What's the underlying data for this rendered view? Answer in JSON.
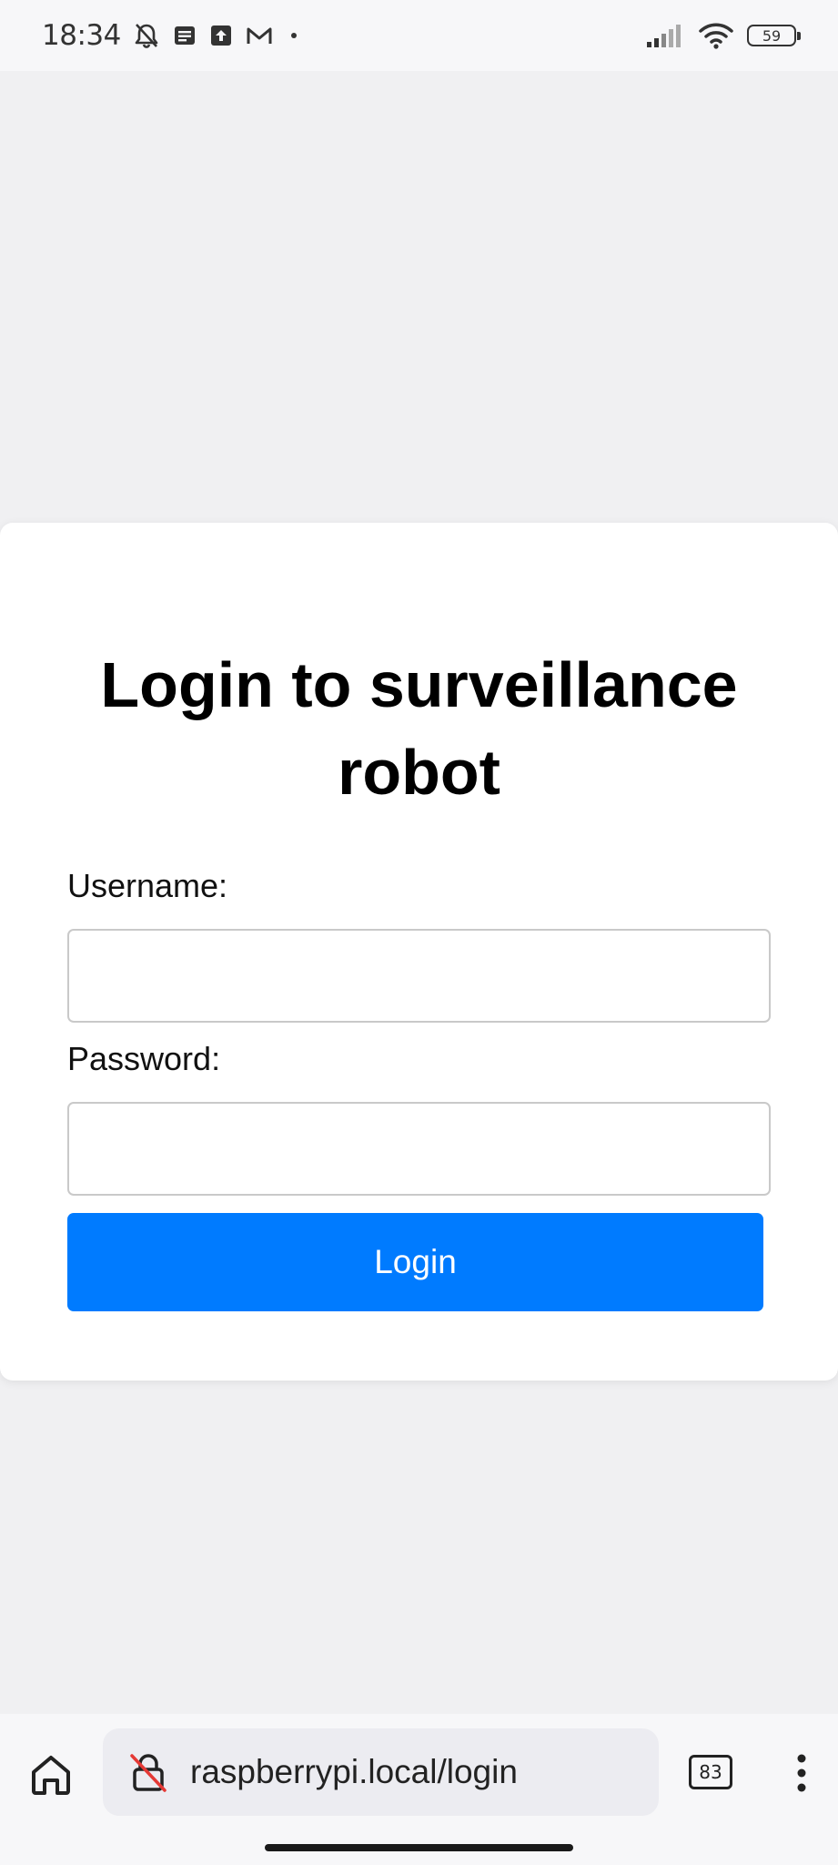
{
  "status_bar": {
    "time": "18:34",
    "battery_level": "59",
    "icons": [
      "bell-off-icon",
      "message-icon",
      "upload-icon",
      "gmail-icon",
      "dot-icon",
      "signal-icon",
      "wifi-icon",
      "battery-icon"
    ]
  },
  "card": {
    "title": "Login to surveillance robot",
    "username_label": "Username:",
    "username_value": "",
    "password_label": "Password:",
    "password_value": "",
    "login_label": "Login"
  },
  "browser": {
    "url": "raspberrypi.local/login",
    "tab_count": "83",
    "icons": [
      "home-icon",
      "insecure-lock-icon",
      "tabs-icon",
      "more-vert-icon"
    ]
  },
  "colors": {
    "page_background": "#f0f0f2",
    "card_background": "#ffffff",
    "button_blue": "#007bff",
    "insecure_slash": "#e53935"
  }
}
